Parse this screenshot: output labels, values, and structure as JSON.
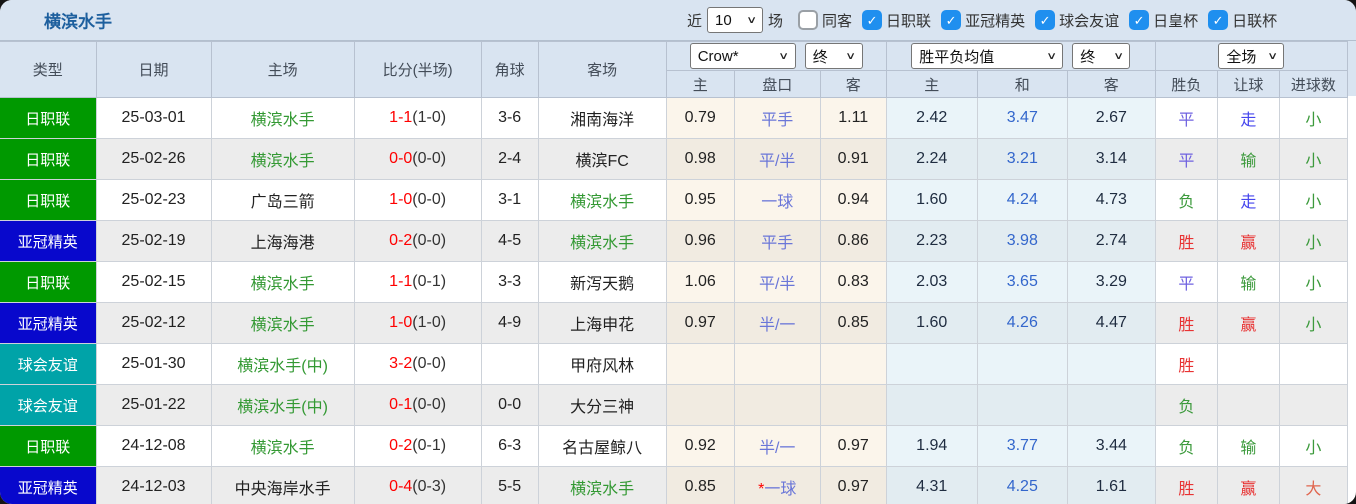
{
  "palette": {
    "panel_header_bg": "#d9e4f1",
    "title_blue": "#1d5f9e",
    "checkbox_on_blue": "#1f8fef",
    "badge_j1_green": "#009900",
    "badge_acl_blue": "#0808cc",
    "badge_friendly_teal": "#00a3a8",
    "team_highlight_green": "#339933",
    "score_red": "#ff0000",
    "handicap_violet": "#6a76d8",
    "avg_draw_blue": "#3366cc",
    "win_red": "#e83333",
    "draw_violet": "#6f62e0",
    "lose_green": "#3c9a3c",
    "over_orange": "#e0664f"
  },
  "header": {
    "title": "横滨水手",
    "filter_bar": {
      "recent_prefix": "近",
      "recent_value": "10",
      "recent_suffix": "场",
      "checkboxes": [
        {
          "label": "同客",
          "checked": false
        },
        {
          "label": "日职联",
          "checked": true
        },
        {
          "label": "亚冠精英",
          "checked": true
        },
        {
          "label": "球会友谊",
          "checked": true
        },
        {
          "label": "日皇杯",
          "checked": true
        },
        {
          "label": "日联杯",
          "checked": true
        }
      ]
    },
    "selects": {
      "company": "Crow*",
      "company_stage": "终",
      "avg_type": "胜平负均值",
      "avg_stage": "终",
      "scope": "全场"
    },
    "columns": {
      "type": "类型",
      "date": "日期",
      "home": "主场",
      "score": "比分(半场)",
      "corner": "角球",
      "away": "客场",
      "odds_home": "主",
      "odds_handicap": "盘口",
      "odds_away": "客",
      "avg_home": "主",
      "avg_draw": "和",
      "avg_away": "客",
      "result": "胜负",
      "handicap_result": "让球",
      "goals": "进球数"
    }
  },
  "rows": [
    {
      "type": "日职联",
      "tkey": "j1",
      "date": "25-03-01",
      "home": "横滨水手",
      "home_hl": true,
      "score": "1-1",
      "half": "(1-0)",
      "corner": "3-6",
      "away": "湘南海洋",
      "away_hl": false,
      "o_home": "0.79",
      "hstar": "",
      "hcap": "平手",
      "o_away": "1.11",
      "a_home": "2.42",
      "a_draw": "3.47",
      "a_away": "2.67",
      "res": "平",
      "res_c": "violet",
      "let": "走",
      "let_c": "blue",
      "goal": "小",
      "goal_c": "green"
    },
    {
      "type": "日职联",
      "tkey": "j1",
      "date": "25-02-26",
      "home": "横滨水手",
      "home_hl": true,
      "score": "0-0",
      "half": "(0-0)",
      "corner": "2-4",
      "away": "横滨FC",
      "away_hl": false,
      "o_home": "0.98",
      "hstar": "",
      "hcap": "平/半",
      "o_away": "0.91",
      "a_home": "2.24",
      "a_draw": "3.21",
      "a_away": "3.14",
      "res": "平",
      "res_c": "violet",
      "let": "输",
      "let_c": "green",
      "goal": "小",
      "goal_c": "green"
    },
    {
      "type": "日职联",
      "tkey": "j1",
      "date": "25-02-23",
      "home": "广岛三箭",
      "home_hl": false,
      "score": "1-0",
      "half": "(0-0)",
      "corner": "3-1",
      "away": "横滨水手",
      "away_hl": true,
      "o_home": "0.95",
      "hstar": "",
      "hcap": "一球",
      "o_away": "0.94",
      "a_home": "1.60",
      "a_draw": "4.24",
      "a_away": "4.73",
      "res": "负",
      "res_c": "green",
      "let": "走",
      "let_c": "blue",
      "goal": "小",
      "goal_c": "green"
    },
    {
      "type": "亚冠精英",
      "tkey": "acl",
      "date": "25-02-19",
      "home": "上海海港",
      "home_hl": false,
      "score": "0-2",
      "half": "(0-0)",
      "corner": "4-5",
      "away": "横滨水手",
      "away_hl": true,
      "o_home": "0.96",
      "hstar": "",
      "hcap": "平手",
      "o_away": "0.86",
      "a_home": "2.23",
      "a_draw": "3.98",
      "a_away": "2.74",
      "res": "胜",
      "res_c": "red",
      "let": "赢",
      "let_c": "red",
      "goal": "小",
      "goal_c": "green"
    },
    {
      "type": "日职联",
      "tkey": "j1",
      "date": "25-02-15",
      "home": "横滨水手",
      "home_hl": true,
      "score": "1-1",
      "half": "(0-1)",
      "corner": "3-3",
      "away": "新泻天鹅",
      "away_hl": false,
      "o_home": "1.06",
      "hstar": "",
      "hcap": "平/半",
      "o_away": "0.83",
      "a_home": "2.03",
      "a_draw": "3.65",
      "a_away": "3.29",
      "res": "平",
      "res_c": "violet",
      "let": "输",
      "let_c": "green",
      "goal": "小",
      "goal_c": "green"
    },
    {
      "type": "亚冠精英",
      "tkey": "acl",
      "date": "25-02-12",
      "home": "横滨水手",
      "home_hl": true,
      "score": "1-0",
      "half": "(1-0)",
      "corner": "4-9",
      "away": "上海申花",
      "away_hl": false,
      "o_home": "0.97",
      "hstar": "",
      "hcap": "半/一",
      "o_away": "0.85",
      "a_home": "1.60",
      "a_draw": "4.26",
      "a_away": "4.47",
      "res": "胜",
      "res_c": "red",
      "let": "赢",
      "let_c": "red",
      "goal": "小",
      "goal_c": "green"
    },
    {
      "type": "球会友谊",
      "tkey": "fr",
      "date": "25-01-30",
      "home": "横滨水手(中)",
      "home_hl": true,
      "score": "3-2",
      "half": "(0-0)",
      "corner": "",
      "away": "甲府风林",
      "away_hl": false,
      "o_home": "",
      "hstar": "",
      "hcap": "",
      "o_away": "",
      "a_home": "",
      "a_draw": "",
      "a_away": "",
      "res": "胜",
      "res_c": "red",
      "let": "",
      "let_c": "",
      "goal": "",
      "goal_c": ""
    },
    {
      "type": "球会友谊",
      "tkey": "fr",
      "date": "25-01-22",
      "home": "横滨水手(中)",
      "home_hl": true,
      "score": "0-1",
      "half": "(0-0)",
      "corner": "0-0",
      "away": "大分三神",
      "away_hl": false,
      "o_home": "",
      "hstar": "",
      "hcap": "",
      "o_away": "",
      "a_home": "",
      "a_draw": "",
      "a_away": "",
      "res": "负",
      "res_c": "green",
      "let": "",
      "let_c": "",
      "goal": "",
      "goal_c": ""
    },
    {
      "type": "日职联",
      "tkey": "j1",
      "date": "24-12-08",
      "home": "横滨水手",
      "home_hl": true,
      "score": "0-2",
      "half": "(0-1)",
      "corner": "6-3",
      "away": "名古屋鲸八",
      "away_hl": false,
      "o_home": "0.92",
      "hstar": "",
      "hcap": "半/一",
      "o_away": "0.97",
      "a_home": "1.94",
      "a_draw": "3.77",
      "a_away": "3.44",
      "res": "负",
      "res_c": "green",
      "let": "输",
      "let_c": "green",
      "goal": "小",
      "goal_c": "green"
    },
    {
      "type": "亚冠精英",
      "tkey": "acl",
      "date": "24-12-03",
      "home": "中央海岸水手",
      "home_hl": false,
      "score": "0-4",
      "half": "(0-3)",
      "corner": "5-5",
      "away": "横滨水手",
      "away_hl": true,
      "o_home": "0.85",
      "hstar": "*",
      "hcap": "一球",
      "o_away": "0.97",
      "a_home": "4.31",
      "a_draw": "4.25",
      "a_away": "1.61",
      "res": "胜",
      "res_c": "red",
      "let": "赢",
      "let_c": "red",
      "goal": "大",
      "goal_c": "orange"
    }
  ]
}
